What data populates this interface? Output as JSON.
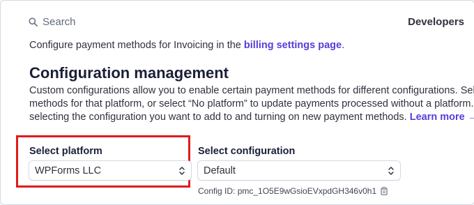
{
  "header": {
    "search_placeholder": "Search",
    "developers_label": "Developers"
  },
  "billing": {
    "text_before": "Configure payment methods for Invoicing in the ",
    "link": "billing settings page",
    "text_after": "."
  },
  "config_management": {
    "title": "Configuration management",
    "line1": "Custom configurations allow you to enable certain payment methods for different configurations. Selec",
    "line2": "methods for that platform, or select “No platform” to update payments processed without a platform. A",
    "line3": "selecting the configuration you want to add to and turning on new payment methods. ",
    "learn_more": "Learn more →"
  },
  "platform": {
    "label": "Select platform",
    "value": "WPForms LLC"
  },
  "configuration": {
    "label": "Select configuration",
    "value": "Default",
    "config_id": "Config ID: pmc_1O5E9wGsioEVxpdGH346v0h1"
  },
  "icons": {
    "search": "search-icon",
    "chevron": "chevron-up-down-icon",
    "copy": "copy-icon"
  },
  "colors": {
    "link": "#5a3cdb",
    "highlight": "#e01b1b"
  }
}
